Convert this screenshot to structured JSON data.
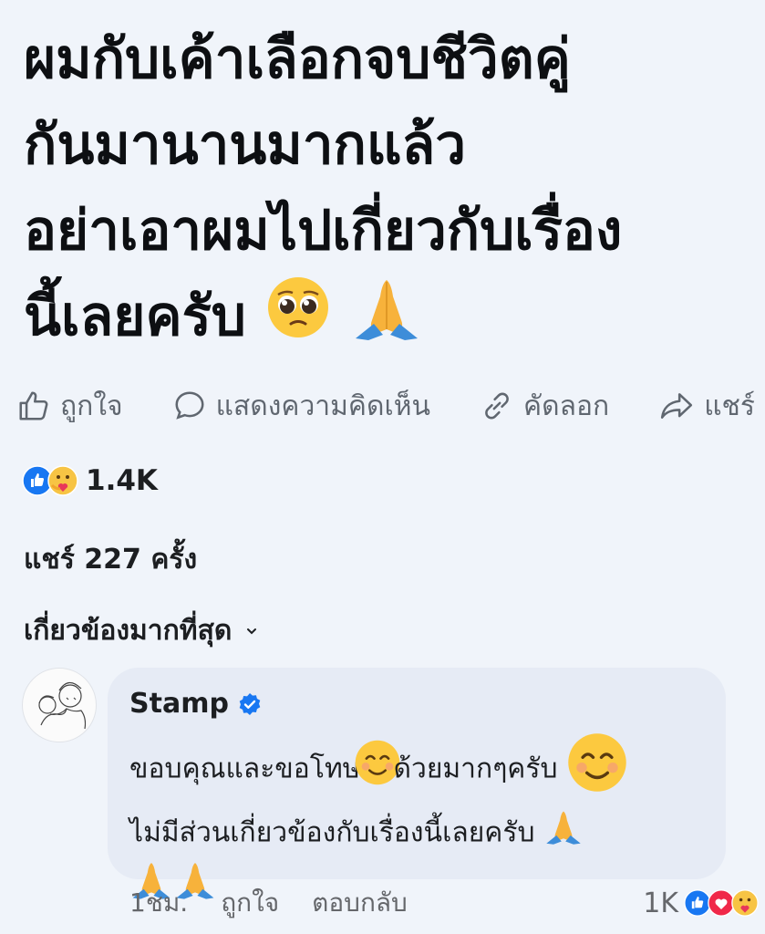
{
  "post": {
    "lines": [
      "ผมกับเค้าเลือกจบชีวิตคู่",
      "กันมานานมากแล้ว",
      "อย่าเอาผมไปเกี่ยวกับเรื่อง",
      "นี้เลยครับ"
    ]
  },
  "actions": {
    "like": "ถูกใจ",
    "comment": "แสดงความคิดเห็น",
    "copy": "คัดลอก",
    "share": "แชร์"
  },
  "reactions": {
    "count": "1.4K"
  },
  "shares": "แชร์ 227 ครั้ง",
  "sort": {
    "label": "เกี่ยวข้องมากที่สุด"
  },
  "comment": {
    "author": "Stamp",
    "verified": true,
    "lines": [
      "ขอบคุณและขอโทษ",
      "ด้วยมากๆครับ",
      "ไม่มีส่วนเกี่ยวข้องกับเรื่องนี้เลยครับ"
    ],
    "time": "1ชม.",
    "like": "ถูกใจ",
    "reply": "ตอบกลับ",
    "reaction_count": "1K"
  },
  "colors": {
    "bg": "#f0f4fa",
    "bubble": "#e6ebf5",
    "blue": "#1877f2",
    "grey": "#65676b"
  },
  "icons": [
    "like-icon",
    "comment-icon",
    "link-icon",
    "share-icon",
    "verified-badge-icon",
    "pleading-face-icon",
    "folded-hands-icon",
    "smiling-face-icon",
    "love-icon",
    "care-icon"
  ]
}
